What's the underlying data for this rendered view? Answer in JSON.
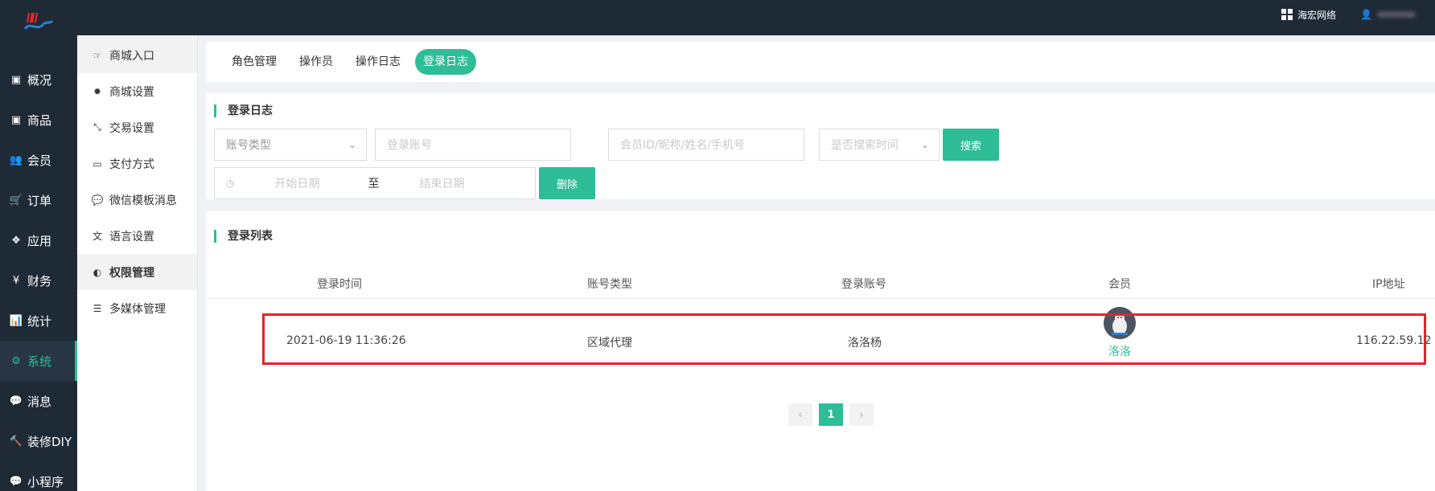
{
  "brand": {
    "logo_name": "hh-wave-logo"
  },
  "topbar": {
    "shop_name": "海宏网络",
    "user_icon": "user-icon"
  },
  "leftnav": {
    "items": [
      {
        "label": "概况",
        "icon": "dashboard-icon"
      },
      {
        "label": "商品",
        "icon": "archive-icon"
      },
      {
        "label": "会员",
        "icon": "users-icon"
      },
      {
        "label": "订单",
        "icon": "cart-icon"
      },
      {
        "label": "应用",
        "icon": "apps-icon"
      },
      {
        "label": "财务",
        "icon": "yen-icon"
      },
      {
        "label": "统计",
        "icon": "bar-chart-icon"
      },
      {
        "label": "系统",
        "icon": "cogs-icon",
        "active": true
      },
      {
        "label": "消息",
        "icon": "comment-icon"
      },
      {
        "label": "装修DIY",
        "icon": "hammer-icon"
      },
      {
        "label": "小程序",
        "icon": "wechat-icon"
      }
    ]
  },
  "subnav": {
    "items": [
      {
        "label": "商城入口",
        "icon": "hand-right-icon"
      },
      {
        "label": "商城设置",
        "icon": "gear-icon"
      },
      {
        "label": "交易设置",
        "icon": "compress-icon"
      },
      {
        "label": "支付方式",
        "icon": "credit-card-icon"
      },
      {
        "label": "微信模板消息",
        "icon": "wechat-icon"
      },
      {
        "label": "语言设置",
        "icon": "translate-icon"
      },
      {
        "label": "权限管理",
        "icon": "key-icon"
      },
      {
        "label": "多媒体管理",
        "icon": "list-icon"
      }
    ]
  },
  "tabs": [
    {
      "label": "角色管理"
    },
    {
      "label": "操作员"
    },
    {
      "label": "操作日志"
    },
    {
      "label": "登录日志",
      "active": true
    }
  ],
  "search": {
    "title": "登录日志",
    "account_type_placeholder": "账号类型",
    "login_account_placeholder": "登录账号",
    "member_placeholder": "会员ID/昵称/姓名/手机号",
    "time_filter_placeholder": "是否搜索时间",
    "search_button": "搜索",
    "start_date_placeholder": "开始日期",
    "to_label": "至",
    "end_date_placeholder": "结束日期",
    "delete_button": "删除"
  },
  "list": {
    "title": "登录列表",
    "headers": [
      "登录时间",
      "账号类型",
      "登录账号",
      "会员",
      "IP地址"
    ],
    "rows": [
      {
        "time": "2021-06-19 11:36:26",
        "type": "区域代理",
        "account": "洛洛杨",
        "member": "洛洛",
        "ip": "116.22.59.12"
      }
    ]
  },
  "pager": {
    "prev": "‹",
    "current": "1",
    "next": "›"
  },
  "colors": {
    "accent": "#2ebd96",
    "nav_bg": "#1f2a37",
    "highlight": "#e0262b"
  }
}
